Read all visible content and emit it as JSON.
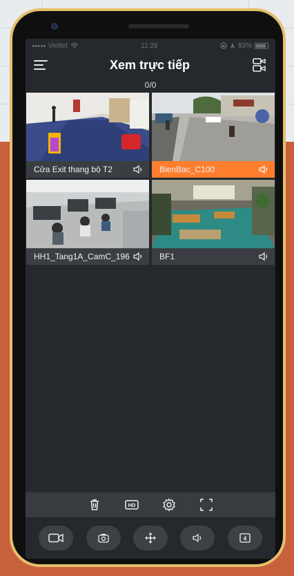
{
  "status_bar": {
    "carrier": "Viettel",
    "time": "11:29",
    "battery": "83%"
  },
  "header": {
    "title": "Xem trực tiếp"
  },
  "counter": "0/0",
  "cameras": [
    {
      "name": "Cửa Exit thang bộ T2",
      "active": false
    },
    {
      "name": "BienBac_C100",
      "active": true
    },
    {
      "name": "HH1_Tang1A_CamC_196",
      "active": false
    },
    {
      "name": "BF1",
      "active": false
    }
  ],
  "toolbar": {
    "hd_label": "HD"
  },
  "bottom_bar": {
    "layout_count": "4"
  },
  "colors": {
    "accent": "#ff7e2e",
    "screen_bg": "#25282c",
    "frame": "#e5c06b",
    "page_bg": "#c9603c"
  },
  "icons": [
    "hamburger-icon",
    "camera-switch-icon",
    "speaker-icon",
    "trash-icon",
    "hd-icon",
    "gear-icon",
    "fullscreen-icon",
    "video-record-icon",
    "snapshot-icon",
    "ptz-icon",
    "layout-grid-icon"
  ]
}
